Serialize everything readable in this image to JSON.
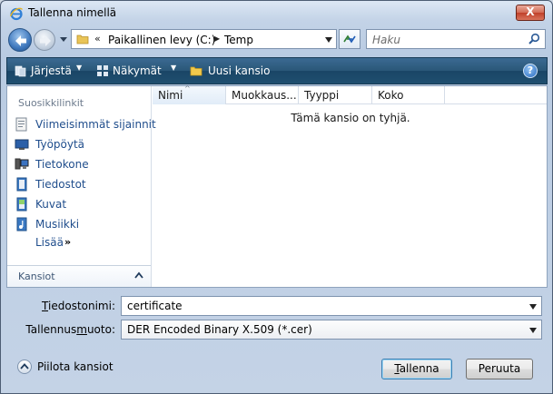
{
  "window": {
    "title": "Tallenna nimellä",
    "close_glyph": "X"
  },
  "address": {
    "chevron": "«",
    "crumbs": [
      "Paikallinen levy (C:)",
      "Temp"
    ],
    "search_placeholder": "Haku"
  },
  "toolbar": {
    "organize": "Järjestä",
    "views": "Näkymät",
    "new_folder": "Uusi kansio",
    "help_glyph": "?"
  },
  "nav": {
    "header": "Suosikkilinkit",
    "links": [
      {
        "label": "Viimeisimmät sijainnit",
        "icon": "recent-places-icon"
      },
      {
        "label": "Työpöytä",
        "icon": "desktop-icon"
      },
      {
        "label": "Tietokone",
        "icon": "computer-icon"
      },
      {
        "label": "Tiedostot",
        "icon": "documents-icon"
      },
      {
        "label": "Kuvat",
        "icon": "pictures-icon"
      },
      {
        "label": "Musiikki",
        "icon": "music-icon"
      }
    ],
    "more": "Lisää",
    "more_glyph": "»",
    "folders": "Kansiot"
  },
  "files": {
    "columns": [
      "Nimi",
      "Muokkaus...",
      "Tyyppi",
      "Koko"
    ],
    "sort_glyph": "^",
    "empty_message": "Tämä kansio on tyhjä."
  },
  "form": {
    "filename_label_key": "T",
    "filename_label_rest": "iedostonimi:",
    "filename_value": "certificate",
    "savetype_label_pre": "Tallennus",
    "savetype_label_key": "m",
    "savetype_label_rest": "uoto:",
    "savetype_value": "DER Encoded Binary X.509 (*.cer)"
  },
  "footer": {
    "hide_folders": "Piilota kansiot",
    "save_key": "T",
    "save_rest": "allenna",
    "cancel": "Peruuta"
  },
  "colors": {
    "toolbar": "#1f4f6f",
    "link": "#1f4d8c",
    "close": "#c0402a"
  }
}
